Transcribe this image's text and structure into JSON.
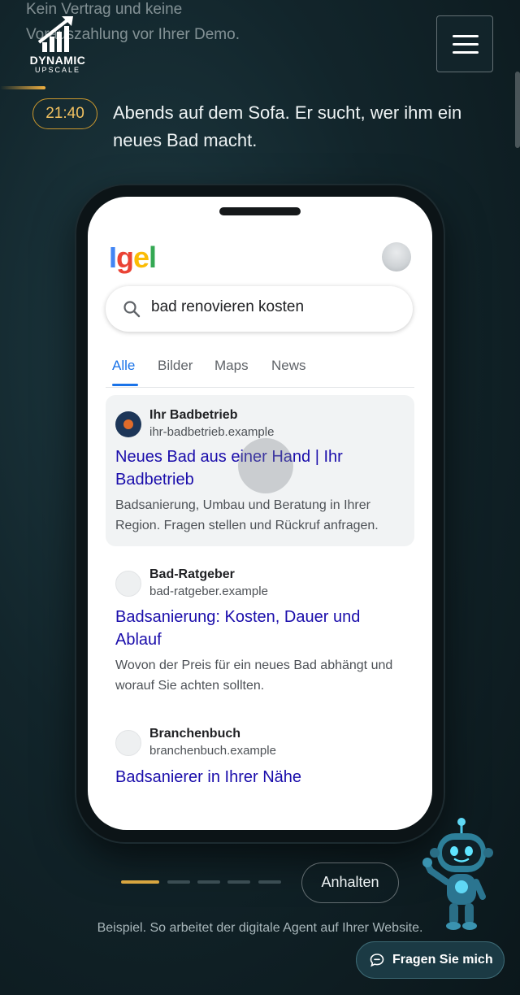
{
  "header": {
    "top_text_line1": "Kein Vertrag und keine",
    "top_text_line2": "Vorauszahlung vor Ihrer Demo.",
    "logo_name": "DYNAMIC",
    "logo_sub": "UPSCALE",
    "menu_icon": "hamburger-icon"
  },
  "scene": {
    "time": "21:40",
    "headline": "Abends auf dem Sofa. Er sucht, wer ihm ein neues Bad macht."
  },
  "phone": {
    "brand_letters": [
      "I",
      "g",
      "e",
      "l"
    ],
    "brand_colors": [
      "#4285f4",
      "#ea4335",
      "#fbbc05",
      "#34a853"
    ],
    "search_query": "bad renovieren kosten",
    "tabs": [
      {
        "label": "Alle",
        "active": true
      },
      {
        "label": "Bilder",
        "active": false
      },
      {
        "label": "Maps",
        "active": false
      },
      {
        "label": "News",
        "active": false
      }
    ],
    "results": [
      {
        "site": "Ihr Badbetrieb",
        "url": "ihr-badbetrieb.example",
        "title": "Neues Bad aus einer Hand | Ihr Badbetrieb",
        "desc": "Badsanierung, Umbau und Beratung in Ihrer Region. Fragen stellen und Rückruf anfragen.",
        "highlighted": true
      },
      {
        "site": "Bad-Ratgeber",
        "url": "bad-ratgeber.example",
        "title": "Badsanierung: Kosten, Dauer und Ablauf",
        "desc": "Wovon der Preis für ein neues Bad abhängt und worauf Sie achten sollten.",
        "highlighted": false
      },
      {
        "site": "Branchenbuch",
        "url": "branchenbuch.example",
        "title": "Badsanierer in Ihrer Nähe",
        "desc": "",
        "highlighted": false
      }
    ]
  },
  "controls": {
    "progress_steps": 6,
    "active_step": 1,
    "pause_label": "Anhalten",
    "caption": "Beispiel. So arbeitet der digitale Agent auf Ihrer Website.",
    "ask_label": "Fragen Sie mich"
  },
  "colors": {
    "accent_gold": "#d9a640",
    "link_blue": "#1a0dab",
    "tab_blue": "#1a73e8"
  }
}
